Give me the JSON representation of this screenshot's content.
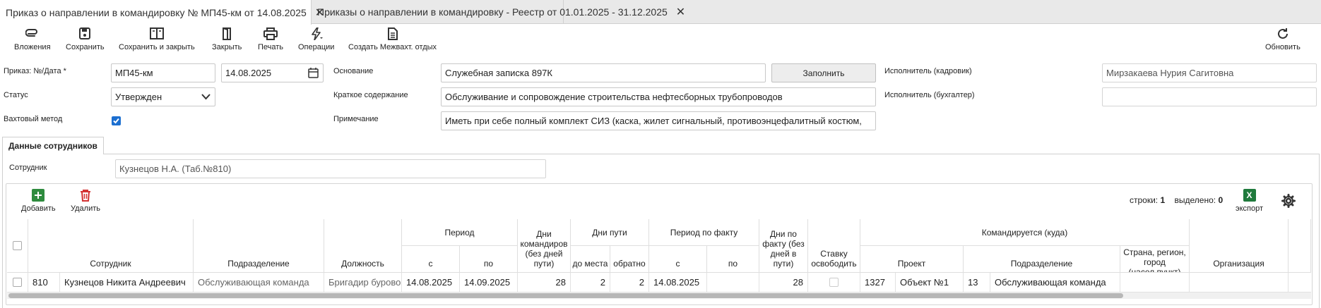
{
  "tabs": [
    {
      "label": "Приказ о направлении в командировку № МП45-км от 14.08.2025"
    },
    {
      "label": "Приказы о направлении в командировку - Реестр от 01.01.2025 - 31.12.2025"
    }
  ],
  "toolbar": {
    "attachments": "Вложения",
    "save": "Сохранить",
    "save_close": "Сохранить и закрыть",
    "close": "Закрыть",
    "print": "Печать",
    "operations": "Операции",
    "create_shift": "Создать Межвахт. отдых",
    "refresh": "Обновить"
  },
  "form": {
    "order_label": "Приказ: №/Дата *",
    "order_number": "МП45-км",
    "order_date": "14.08.2025",
    "status_label": "Статус",
    "status_value": "Утвержден",
    "shift_label": "Вахтовый метод",
    "basis_label": "Основание",
    "basis_value": "Служебная записка 897К",
    "fill_button": "Заполнить",
    "summary_label": "Краткое содержание",
    "summary_value": "Обслуживание и сопровождение строительства нефтесборных трубопроводов",
    "note_label": "Примечание",
    "note_value": "Иметь при себе полный комплект СИЗ (каска, жилет сигнальный, противоэнцефалитный костюм,",
    "hr_label": "Исполнитель (кадровик)",
    "hr_value": "Мирзакаева Нурия Сагитовна",
    "acc_label": "Исполнитель (бухгалтер)",
    "acc_value": ""
  },
  "section": {
    "tab": "Данные сотрудников",
    "employee_label": "Сотрудник",
    "employee_value": "Кузнецов Н.А. (Таб.№810)"
  },
  "grid": {
    "add": "Добавить",
    "delete": "Удалить",
    "rows_label": "строки:",
    "rows_count": "1",
    "selected_label": "выделено:",
    "selected_count": "0",
    "export": "экспорт",
    "headers": {
      "employee": "Сотрудник",
      "department": "Подразделение",
      "position": "Должность",
      "period": "Период",
      "from": "с",
      "to": "по",
      "trip_days": "Дни командиров (без дней пути)",
      "travel_days": "Дни пути",
      "to_place": "до места",
      "back": "обратно",
      "fact_period": "Период по факту",
      "fact_from": "с",
      "fact_to": "по",
      "fact_days": "Дни по факту (без дней в пути)",
      "release": "Ставку освободить",
      "sent_to": "Командируется (куда)",
      "project": "Проект",
      "dest_department": "Подразделение",
      "location": "Страна, регион, город (насел.пункт)",
      "organization": "Организация"
    },
    "row": {
      "tab_no": "810",
      "employee": "Кузнецов Никита Андреевич",
      "department": "Обслуживающая команда",
      "position": "Бригадир буровой",
      "from": "14.08.2025",
      "to": "14.09.2025",
      "trip_days": "28",
      "to_place": "2",
      "back": "2",
      "fact_from": "14.08.2025",
      "fact_to": "",
      "fact_days": "28",
      "project_code": "1327",
      "project": "Объект №1",
      "dept_code": "13",
      "dest_department": "Обслуживающая команда",
      "location": "",
      "organization": ""
    }
  },
  "colors": {
    "accent": "#1c6fd0",
    "add_green": "#2e8b3e",
    "delete_red": "#d33333",
    "export_green": "#1f7a3c"
  }
}
